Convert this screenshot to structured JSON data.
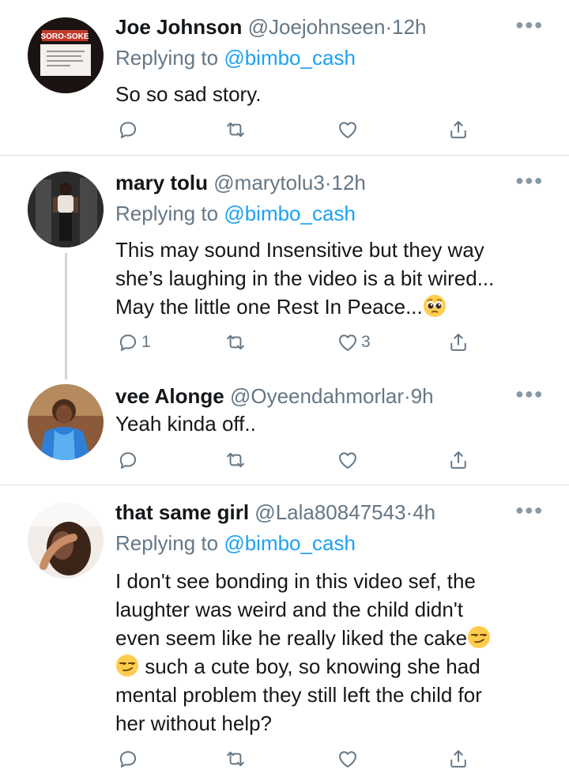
{
  "tweets": [
    {
      "name": "Joe Johnson",
      "handle": "@Joejohnseen",
      "dot": "·",
      "time": "12h",
      "replying_prefix": "Replying to ",
      "replying_to": "@bimbo_cash",
      "text": "So so sad story.",
      "avatar_text": "SORO-SOKE",
      "reply_count": "",
      "retweet_count": "",
      "like_count": ""
    },
    {
      "name": "mary tolu",
      "handle": "@marytolu3",
      "dot": "·",
      "time": "12h",
      "replying_prefix": "Replying to ",
      "replying_to": "@bimbo_cash",
      "text_lines": [
        "This may sound Insensitive but they way",
        "she’s laughing in the video is a bit wired...",
        "May the little one Rest In Peace..."
      ],
      "reply_count": "1",
      "retweet_count": "",
      "like_count": "3"
    },
    {
      "name": "vee Alonge",
      "handle": "@Oyeendahmorlar",
      "dot": "·",
      "time": "9h",
      "text": "Yeah kinda off..",
      "reply_count": "",
      "retweet_count": "",
      "like_count": ""
    },
    {
      "name": "that same girl",
      "handle": "@Lala80847543",
      "dot": "·",
      "time": "4h",
      "replying_prefix": "Replying to ",
      "replying_to": "@bimbo_cash",
      "text_lines": [
        "I don't see bonding in this video sef, the",
        "laughter was weird and the child didn't",
        "even seem like he really liked the cake",
        " such a cute boy, so knowing she had",
        "mental problem they still left the child for",
        "her without help?"
      ],
      "reply_count": "",
      "retweet_count": "",
      "like_count": ""
    }
  ],
  "colors": {
    "link": "#1da1f2",
    "meta": "#657786",
    "divider": "#d8dde2"
  },
  "icons": [
    "reply-icon",
    "retweet-icon",
    "like-icon",
    "share-icon",
    "more-icon",
    "pleading-face-emoji",
    "smirk-emoji"
  ]
}
